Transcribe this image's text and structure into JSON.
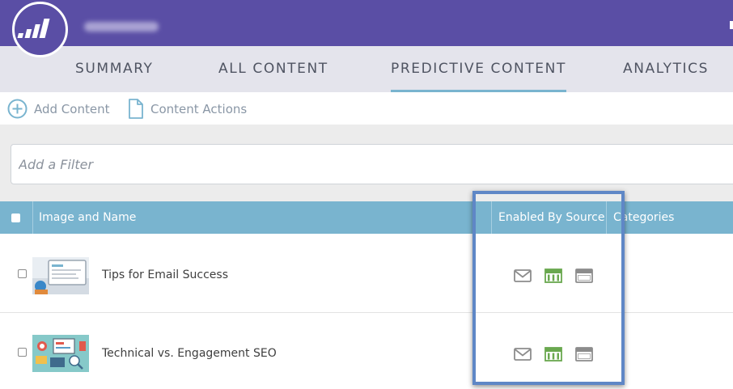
{
  "nav": {
    "tabs": [
      {
        "label": "SUMMARY"
      },
      {
        "label": "ALL CONTENT"
      },
      {
        "label": "PREDICTIVE CONTENT",
        "active": true
      },
      {
        "label": "ANALYTICS"
      }
    ]
  },
  "toolbar": {
    "add_content": "Add Content",
    "content_actions": "Content Actions"
  },
  "filter": {
    "placeholder": "Add a Filter"
  },
  "table": {
    "columns": [
      "Image and Name",
      "Enabled By Source",
      "Categories"
    ],
    "rows": [
      {
        "name": "Tips for Email Success",
        "sources": [
          "email-icon",
          "web-page-icon",
          "browser-window-icon"
        ]
      },
      {
        "name": "Technical vs. Engagement SEO",
        "sources": [
          "email-icon",
          "web-page-icon",
          "browser-window-icon"
        ]
      }
    ]
  },
  "colors": {
    "header_bar": "#5a4ea5",
    "nav_bg": "#e4e4ec",
    "accent": "#79b4cf",
    "enabled_source": "#6aa84f",
    "disabled_source": "#8c8c8c",
    "highlight": "#5f87c6"
  }
}
